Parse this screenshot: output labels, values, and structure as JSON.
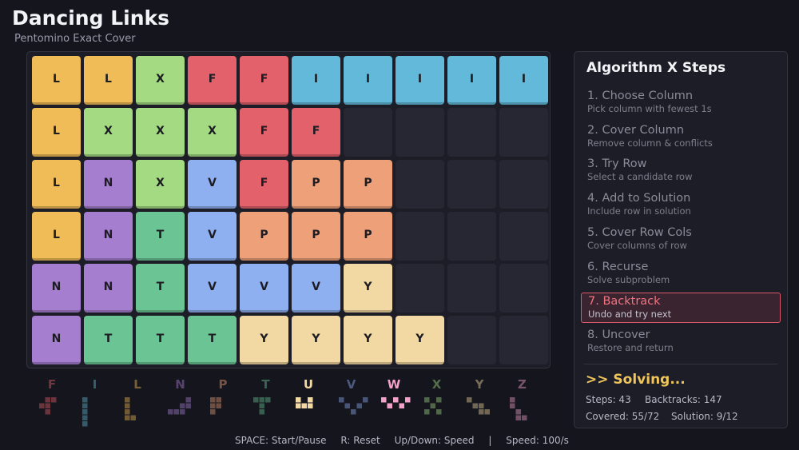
{
  "header": {
    "title": "Dancing Links",
    "subtitle": "Pentomino Exact Cover"
  },
  "colors": {
    "L": "#f0bc58",
    "X": "#a3da82",
    "F": "#e2616b",
    "I": "#62b9da",
    "N": "#a67ed0",
    "V": "#8eaff0",
    "P": "#eea079",
    "T": "#6bc494",
    "Y": "#f2d8a2"
  },
  "board": {
    "rows": [
      [
        "L",
        "L",
        "X",
        "F",
        "F",
        "I",
        "I",
        "I",
        "I",
        "I"
      ],
      [
        "L",
        "X",
        "X",
        "X",
        "F",
        "F",
        "",
        "",
        "",
        ""
      ],
      [
        "L",
        "N",
        "X",
        "V",
        "F",
        "P",
        "P",
        "",
        "",
        ""
      ],
      [
        "L",
        "N",
        "T",
        "V",
        "P",
        "P",
        "P",
        "",
        "",
        ""
      ],
      [
        "N",
        "N",
        "T",
        "V",
        "V",
        "V",
        "Y",
        "",
        "",
        ""
      ],
      [
        "N",
        "T",
        "T",
        "T",
        "Y",
        "Y",
        "Y",
        "Y",
        "",
        ""
      ]
    ]
  },
  "panel": {
    "title": "Algorithm X Steps",
    "steps": [
      {
        "title": "1. Choose Column",
        "desc": "Pick column with fewest 1s"
      },
      {
        "title": "2. Cover Column",
        "desc": "Remove column & conflicts"
      },
      {
        "title": "3. Try Row",
        "desc": "Select a candidate row"
      },
      {
        "title": "4. Add to Solution",
        "desc": "Include row in solution"
      },
      {
        "title": "5. Cover Row Cols",
        "desc": "Cover columns of row"
      },
      {
        "title": "6. Recurse",
        "desc": "Solve subproblem"
      },
      {
        "title": "7. Backtrack",
        "desc": "Undo and try next"
      },
      {
        "title": "8. Uncover",
        "desc": "Restore and return"
      }
    ],
    "active_step": 6,
    "status": ">> Solving...",
    "stats": {
      "steps": "Steps: 43",
      "backtracks": "Backtracks: 147",
      "covered": "Covered: 55/72",
      "solution": "Solution: 9/12"
    }
  },
  "legend": [
    {
      "letter": "F",
      "color": "#e2616b",
      "used": false,
      "cells": [
        [
          1,
          0
        ],
        [
          2,
          0
        ],
        [
          0,
          1
        ],
        [
          1,
          1
        ],
        [
          1,
          2
        ]
      ]
    },
    {
      "letter": "I",
      "color": "#62b9da",
      "used": false,
      "cells": [
        [
          0,
          0
        ],
        [
          0,
          1
        ],
        [
          0,
          2
        ],
        [
          0,
          3
        ],
        [
          0,
          4
        ]
      ]
    },
    {
      "letter": "L",
      "color": "#f0bc58",
      "used": false,
      "cells": [
        [
          0,
          0
        ],
        [
          0,
          1
        ],
        [
          0,
          2
        ],
        [
          0,
          3
        ],
        [
          1,
          3
        ]
      ]
    },
    {
      "letter": "N",
      "color": "#a67ed0",
      "used": false,
      "cells": [
        [
          3,
          0
        ],
        [
          2,
          1
        ],
        [
          3,
          1
        ],
        [
          0,
          2
        ],
        [
          1,
          2
        ],
        [
          2,
          2
        ]
      ]
    },
    {
      "letter": "P",
      "color": "#eea079",
      "used": false,
      "cells": [
        [
          0,
          0
        ],
        [
          1,
          0
        ],
        [
          0,
          1
        ],
        [
          1,
          1
        ],
        [
          0,
          2
        ]
      ]
    },
    {
      "letter": "T",
      "color": "#6bc494",
      "used": false,
      "cells": [
        [
          0,
          0
        ],
        [
          1,
          0
        ],
        [
          2,
          0
        ],
        [
          1,
          1
        ],
        [
          1,
          2
        ]
      ]
    },
    {
      "letter": "U",
      "color": "#f2d8a2",
      "used": true,
      "cells": [
        [
          0,
          0
        ],
        [
          2,
          0
        ],
        [
          0,
          1
        ],
        [
          1,
          1
        ],
        [
          2,
          1
        ]
      ]
    },
    {
      "letter": "V",
      "color": "#8eaff0",
      "used": false,
      "cells": [
        [
          0,
          0
        ],
        [
          4,
          0
        ],
        [
          1,
          1
        ],
        [
          3,
          1
        ],
        [
          2,
          2
        ]
      ]
    },
    {
      "letter": "W",
      "color": "#f2a2c8",
      "used": true,
      "cells": [
        [
          0,
          0
        ],
        [
          1,
          1
        ],
        [
          2,
          0
        ],
        [
          3,
          1
        ],
        [
          4,
          0
        ]
      ]
    },
    {
      "letter": "X",
      "color": "#a3da82",
      "used": false,
      "cells": [
        [
          0,
          0
        ],
        [
          2,
          0
        ],
        [
          1,
          1
        ],
        [
          0,
          2
        ],
        [
          2,
          2
        ]
      ]
    },
    {
      "letter": "Y",
      "color": "#f2d8a2",
      "used": false,
      "cells": [
        [
          0,
          0
        ],
        [
          1,
          1
        ],
        [
          2,
          1
        ],
        [
          3,
          2
        ],
        [
          2,
          2
        ]
      ]
    },
    {
      "letter": "Z",
      "color": "#f2a2c8",
      "used": false,
      "cells": [
        [
          0,
          0
        ],
        [
          0,
          1
        ],
        [
          1,
          2
        ],
        [
          1,
          3
        ],
        [
          2,
          3
        ]
      ]
    }
  ],
  "footer": {
    "controls": "SPACE: Start/Pause",
    "reset": "R: Reset",
    "speed_keys": "Up/Down: Speed",
    "sep": "|",
    "speed": "Speed: 100/s"
  }
}
